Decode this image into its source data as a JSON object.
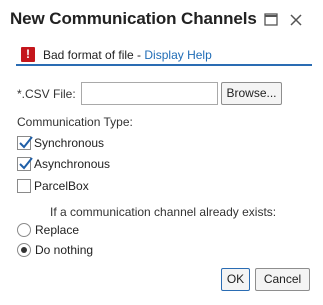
{
  "dialog": {
    "title": "New Communication Channels"
  },
  "message": {
    "icon": "error-icon",
    "icon_glyph": "!",
    "text": "Bad format of file",
    "separator": " - ",
    "link": "Display Help",
    "accent_color": "#2a6cb3",
    "error_color": "#c4161c"
  },
  "file": {
    "label": "*.CSV File:",
    "value": "",
    "browse_label": "Browse..."
  },
  "communication_type": {
    "label": "Communication Type:",
    "options": [
      {
        "label": "Synchronous",
        "checked": true
      },
      {
        "label": "Asynchronous",
        "checked": true
      },
      {
        "label": "ParcelBox",
        "checked": false
      }
    ]
  },
  "exists": {
    "label": "If a communication channel already exists:",
    "options": [
      {
        "label": "Replace",
        "selected": false
      },
      {
        "label": "Do nothing",
        "selected": true
      }
    ]
  },
  "buttons": {
    "ok": "OK",
    "cancel": "Cancel"
  }
}
